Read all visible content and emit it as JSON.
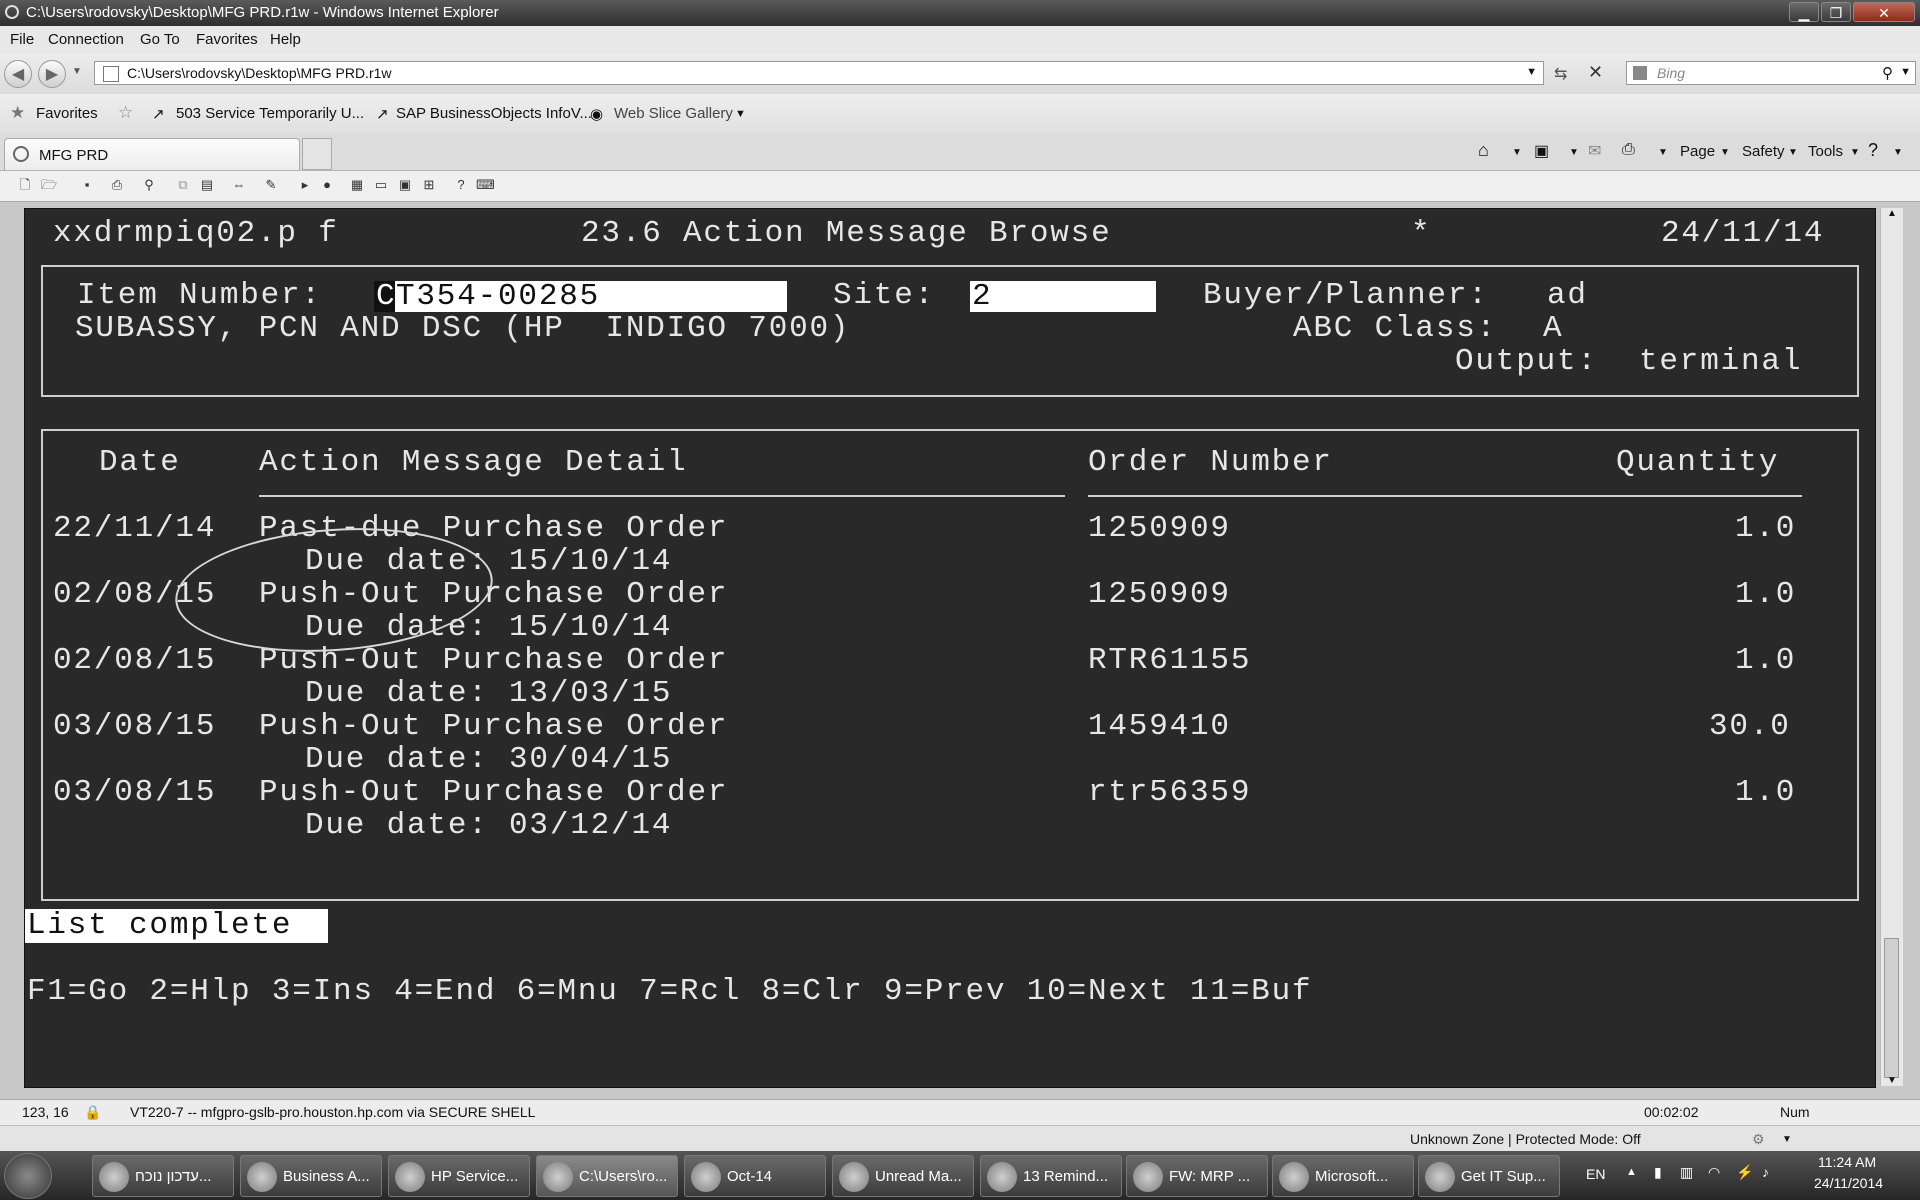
{
  "window": {
    "title": "C:\\Users\\rodovsky\\Desktop\\MFG PRD.r1w - Windows Internet Explorer",
    "minimize": "▁",
    "maximize": "❐",
    "close": "✕"
  },
  "menu": [
    "File",
    "Connection",
    "Go To",
    "Favorites",
    "Help"
  ],
  "address": {
    "url": "C:\\Users\\rodovsky\\Desktop\\MFG PRD.r1w",
    "search_placeholder": "Bing"
  },
  "favorites": {
    "label": "Favorites",
    "items": [
      "503 Service Temporarily U...",
      "SAP BusinessObjects InfoV...",
      "Web Slice Gallery"
    ]
  },
  "tab": {
    "title": "MFG PRD"
  },
  "commandbar": [
    "Page",
    "Safety",
    "Tools"
  ],
  "terminal": {
    "program": "xxdrmpiq02.p f",
    "screen_title": "23.6 Action Message Browse",
    "star": "*",
    "date": "24/11/14",
    "item_label": "Item Number:",
    "item_cursor": "C",
    "item_value": "T354-00285",
    "site_label": "Site:",
    "site_value": "2",
    "buyer_label": "Buyer/Planner:",
    "buyer_value": "ad",
    "description": "SUBASSY, PCN AND DSC (HP  INDIGO 7000)",
    "abc_label": "ABC Class:",
    "abc_value": "A",
    "output_label": "Output:",
    "output_value": "terminal",
    "columns": {
      "date": "Date",
      "detail": "Action Message Detail",
      "order": "Order Number",
      "quantity": "Quantity"
    },
    "rows": [
      {
        "date": "22/11/14",
        "detail": "Past-due Purchase Order",
        "due": "Due date: 15/10/14",
        "order": "1250909",
        "quantity": "1.0"
      },
      {
        "date": "02/08/15",
        "detail": "Push-Out Purchase Order",
        "due": "Due date: 15/10/14",
        "order": "1250909",
        "quantity": "1.0"
      },
      {
        "date": "02/08/15",
        "detail": "Push-Out Purchase Order",
        "due": "Due date: 13/03/15",
        "order": "RTR61155",
        "quantity": "1.0"
      },
      {
        "date": "03/08/15",
        "detail": "Push-Out Purchase Order",
        "due": "Due date: 30/04/15",
        "order": "1459410",
        "quantity": "30.0"
      },
      {
        "date": "03/08/15",
        "detail": "Push-Out Purchase Order",
        "due": "Due date: 03/12/14",
        "order": "rtr56359",
        "quantity": "1.0"
      }
    ],
    "status_message": "List complete",
    "function_keys": "F1=Go 2=Hlp 3=Ins 4=End 6=Mnu 7=Rcl 8=Clr 9=Prev 10=Next 11=Buf"
  },
  "statusbar": {
    "cursor_pos": "123, 16",
    "connection": "VT220-7 -- mfgpro-gslb-pro.houston.hp.com via SECURE SHELL",
    "timer": "00:02:02",
    "num": "Num",
    "zone": "Unknown Zone | Protected Mode: Off"
  },
  "taskbar": {
    "items": [
      "עדכון נוכח...",
      "Business A...",
      "HP Service...",
      "C:\\Users\\ro...",
      "Oct-14",
      "Unread Ma...",
      "13 Remind...",
      "FW: MRP ...",
      "Microsoft...",
      "Get IT Sup..."
    ],
    "language": "EN",
    "time": "11:24 AM",
    "date": "24/11/2014"
  }
}
